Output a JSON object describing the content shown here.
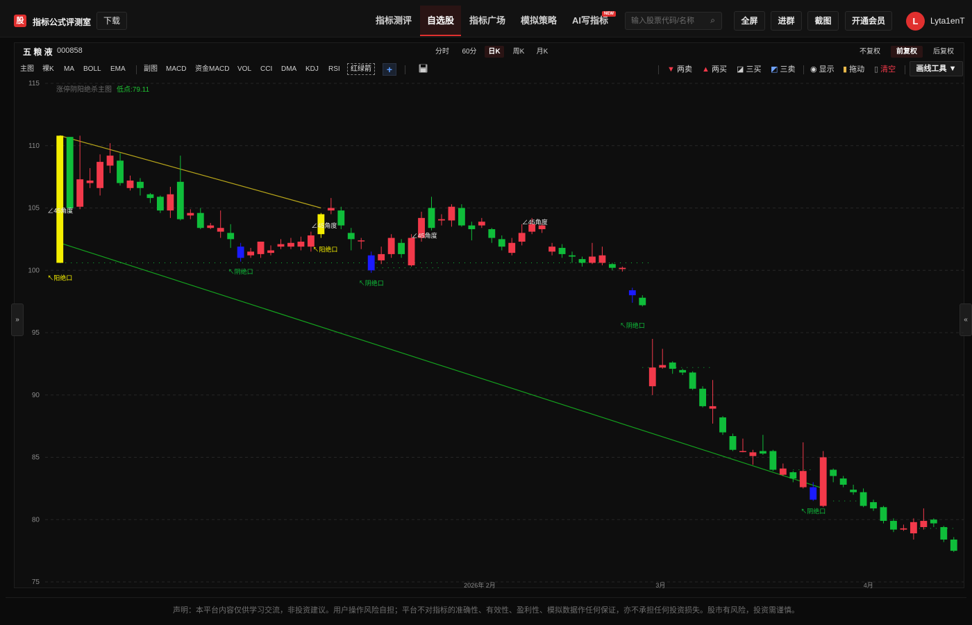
{
  "app": {
    "logo_char": "股",
    "title": "指标公式评测室",
    "download_label": "下载"
  },
  "nav": [
    {
      "label": "指标测评",
      "active": false
    },
    {
      "label": "自选股",
      "active": true
    },
    {
      "label": "指标广场",
      "active": false
    },
    {
      "label": "模拟策略",
      "active": false
    },
    {
      "label": "AI写指标",
      "active": false,
      "badge": "NEW"
    }
  ],
  "search": {
    "placeholder": "输入股票代码/名称",
    "icon": "search-icon"
  },
  "toolbar": {
    "fullscreen": "全屏",
    "join_group": "进群",
    "screenshot": "截图",
    "membership": "开通会员"
  },
  "user": {
    "initial": "L",
    "name": "Lyta1enT"
  },
  "stock": {
    "name": "五 粮 液",
    "code": "000858"
  },
  "periods": [
    {
      "label": "分时",
      "active": false
    },
    {
      "label": "60分",
      "active": false
    },
    {
      "label": "日K",
      "active": true
    },
    {
      "label": "周K",
      "active": false
    },
    {
      "label": "月K",
      "active": false
    }
  ],
  "adjust": [
    {
      "label": "不复权",
      "active": false
    },
    {
      "label": "前复权",
      "active": true
    },
    {
      "label": "后复权",
      "active": false
    }
  ],
  "indicators_main": [
    "主图",
    "裸K",
    "MA",
    "BOLL",
    "EMA"
  ],
  "indicators_sub": [
    "副图",
    "MACD",
    "资金MACD",
    "VOL",
    "CCI",
    "DMA",
    "KDJ",
    "RSI"
  ],
  "indicator_highlight": "红绿箭",
  "signals": {
    "two_sell": "两卖",
    "two_buy": "两买",
    "three_buy": "三买",
    "three_sell": "三卖",
    "show": "显示",
    "drag": "拖动",
    "clear": "清空",
    "draw_tool": "画线工具 ▼"
  },
  "colors": {
    "up": "#f2394a",
    "down": "#0fbd3a",
    "accent": "#e0302f",
    "blue": "#1b1bff",
    "yellow": "#f5ef00",
    "trend_top": "#b8a61a",
    "trend_bottom": "#14a11e"
  },
  "chart_data": {
    "type": "candlestick",
    "main_label": "涨停阴阳绝杀主图",
    "low_label": "低点:79.11",
    "y_ticks": [
      115,
      110,
      105,
      100,
      95,
      90,
      85,
      80,
      75
    ],
    "ylim": [
      75,
      115
    ],
    "x_labels": [
      "2026年 2月",
      "3月",
      "4月"
    ],
    "angle_label": "∠45角度",
    "yang_label": "↖阳绝口",
    "yin_label": "↖阴绝口",
    "candles": [
      {
        "o": 100.6,
        "c": 110.8,
        "h": 110.8,
        "l": 100.6,
        "color": "yellow"
      },
      {
        "o": 110.7,
        "c": 105.0,
        "h": 110.7,
        "l": 104.6
      },
      {
        "o": 105.1,
        "c": 107.3,
        "h": 110.8,
        "l": 104.9
      },
      {
        "o": 107.0,
        "c": 107.2,
        "h": 108.2,
        "l": 106.6
      },
      {
        "o": 106.6,
        "c": 108.7,
        "h": 109.3,
        "l": 106.0
      },
      {
        "o": 108.4,
        "c": 109.2,
        "h": 110.2,
        "l": 107.8
      },
      {
        "o": 108.8,
        "c": 107.0,
        "h": 109.4,
        "l": 106.8
      },
      {
        "o": 106.6,
        "c": 107.2,
        "h": 107.6,
        "l": 106.4
      },
      {
        "o": 107.1,
        "c": 106.6,
        "h": 107.4,
        "l": 106.0
      },
      {
        "o": 106.1,
        "c": 105.8,
        "h": 106.2,
        "l": 105.4
      },
      {
        "o": 105.9,
        "c": 104.8,
        "h": 106.0,
        "l": 104.6
      },
      {
        "o": 104.8,
        "c": 106.1,
        "h": 106.7,
        "l": 104.2
      },
      {
        "o": 107.1,
        "c": 104.1,
        "h": 109.2,
        "l": 104.0
      },
      {
        "o": 104.4,
        "c": 104.6,
        "h": 104.9,
        "l": 104.1
      },
      {
        "o": 104.6,
        "c": 103.4,
        "h": 105.0,
        "l": 103.3
      },
      {
        "o": 103.4,
        "c": 103.6,
        "h": 103.8,
        "l": 103.3
      },
      {
        "o": 103.1,
        "c": 103.4,
        "h": 104.8,
        "l": 102.6
      },
      {
        "o": 103.0,
        "c": 102.5,
        "h": 103.7,
        "l": 101.8
      },
      {
        "o": 101.9,
        "c": 101.0,
        "h": 102.2,
        "l": 100.7,
        "color": "blue"
      },
      {
        "o": 101.2,
        "c": 101.5,
        "h": 101.8,
        "l": 101.0
      },
      {
        "o": 101.3,
        "c": 102.3,
        "h": 102.3,
        "l": 101.0
      },
      {
        "o": 101.4,
        "c": 101.6,
        "h": 102.0,
        "l": 101.2
      },
      {
        "o": 101.9,
        "c": 102.1,
        "h": 102.5,
        "l": 101.7
      },
      {
        "o": 101.9,
        "c": 102.2,
        "h": 102.6,
        "l": 101.7
      },
      {
        "o": 101.9,
        "c": 102.3,
        "h": 102.7,
        "l": 101.6
      },
      {
        "o": 101.9,
        "c": 102.8,
        "h": 103.1,
        "l": 101.5
      },
      {
        "o": 102.9,
        "c": 104.5,
        "h": 104.6,
        "l": 102.6,
        "color": "yellow"
      },
      {
        "o": 104.8,
        "c": 105.0,
        "h": 105.8,
        "l": 104.5
      },
      {
        "o": 104.8,
        "c": 103.6,
        "h": 105.1,
        "l": 103.3
      },
      {
        "o": 103.0,
        "c": 102.5,
        "h": 103.4,
        "l": 101.6
      },
      {
        "o": 102.4,
        "c": 102.4,
        "h": 102.6,
        "l": 101.7
      },
      {
        "o": 101.2,
        "c": 100.0,
        "h": 101.5,
        "l": 99.8,
        "color": "blue"
      },
      {
        "o": 100.8,
        "c": 101.3,
        "h": 101.9,
        "l": 100.5
      },
      {
        "o": 101.3,
        "c": 102.6,
        "h": 102.9,
        "l": 101.0
      },
      {
        "o": 102.2,
        "c": 101.3,
        "h": 102.5,
        "l": 101.0
      },
      {
        "o": 100.4,
        "c": 102.6,
        "h": 102.9,
        "l": 100.3
      },
      {
        "o": 102.6,
        "c": 104.2,
        "h": 104.7,
        "l": 102.3
      },
      {
        "o": 105.0,
        "c": 103.4,
        "h": 105.9,
        "l": 103.2
      },
      {
        "o": 104.0,
        "c": 104.1,
        "h": 104.5,
        "l": 103.6
      },
      {
        "o": 104.0,
        "c": 105.1,
        "h": 105.3,
        "l": 103.5
      },
      {
        "o": 105.0,
        "c": 103.6,
        "h": 105.3,
        "l": 103.5
      },
      {
        "o": 103.6,
        "c": 103.3,
        "h": 103.9,
        "l": 102.4
      },
      {
        "o": 103.6,
        "c": 103.9,
        "h": 104.2,
        "l": 103.4
      },
      {
        "o": 103.3,
        "c": 102.6,
        "h": 103.4,
        "l": 102.2
      },
      {
        "o": 102.5,
        "c": 101.9,
        "h": 102.8,
        "l": 101.6
      },
      {
        "o": 101.4,
        "c": 102.2,
        "h": 102.6,
        "l": 101.2
      },
      {
        "o": 102.3,
        "c": 103.0,
        "h": 103.7,
        "l": 102.0
      },
      {
        "o": 103.1,
        "c": 103.7,
        "h": 104.2,
        "l": 102.9
      },
      {
        "o": 103.3,
        "c": 103.6,
        "h": 103.8,
        "l": 103.0
      },
      {
        "o": 101.5,
        "c": 101.9,
        "h": 102.2,
        "l": 101.2
      },
      {
        "o": 101.8,
        "c": 101.3,
        "h": 102.1,
        "l": 101.0
      },
      {
        "o": 101.2,
        "c": 101.1,
        "h": 101.5,
        "l": 100.6
      },
      {
        "o": 100.9,
        "c": 100.6,
        "h": 101.1,
        "l": 100.3
      },
      {
        "o": 100.6,
        "c": 101.1,
        "h": 102.2,
        "l": 100.5
      },
      {
        "o": 100.6,
        "c": 101.2,
        "h": 101.9,
        "l": 100.4
      },
      {
        "o": 100.5,
        "c": 100.2,
        "h": 100.6,
        "l": 100.0
      },
      {
        "o": 100.1,
        "c": 100.2,
        "h": 100.3,
        "l": 99.9
      },
      {
        "o": 98.4,
        "c": 98.0,
        "h": 98.6,
        "l": 97.4,
        "color": "blue"
      },
      {
        "o": 97.8,
        "c": 97.2,
        "h": 98.0,
        "l": 97.1
      },
      {
        "o": 90.7,
        "c": 92.2,
        "h": 94.5,
        "l": 90.0
      },
      {
        "o": 92.2,
        "c": 92.4,
        "h": 93.7,
        "l": 92.1
      },
      {
        "o": 92.6,
        "c": 92.1,
        "h": 92.7,
        "l": 91.7
      },
      {
        "o": 92.0,
        "c": 91.8,
        "h": 92.1,
        "l": 91.6
      },
      {
        "o": 91.8,
        "c": 90.5,
        "h": 91.9,
        "l": 90.4
      },
      {
        "o": 90.5,
        "c": 89.1,
        "h": 90.7,
        "l": 89.0
      },
      {
        "o": 88.9,
        "c": 89.1,
        "h": 91.2,
        "l": 87.7
      },
      {
        "o": 88.2,
        "c": 87.0,
        "h": 88.3,
        "l": 86.8
      },
      {
        "o": 86.7,
        "c": 85.6,
        "h": 86.9,
        "l": 85.5
      },
      {
        "o": 85.5,
        "c": 85.5,
        "h": 86.5,
        "l": 85.4
      },
      {
        "o": 85.1,
        "c": 85.4,
        "h": 85.6,
        "l": 84.4
      },
      {
        "o": 85.5,
        "c": 85.3,
        "h": 86.8,
        "l": 85.2
      },
      {
        "o": 85.5,
        "c": 84.0,
        "h": 85.6,
        "l": 83.9
      },
      {
        "o": 83.6,
        "c": 84.1,
        "h": 84.5,
        "l": 83.5
      },
      {
        "o": 83.8,
        "c": 83.3,
        "h": 83.9,
        "l": 83.0
      },
      {
        "o": 82.6,
        "c": 83.9,
        "h": 86.2,
        "l": 82.5
      },
      {
        "o": 82.6,
        "c": 81.6,
        "h": 83.0,
        "l": 81.5,
        "color": "blue"
      },
      {
        "o": 81.1,
        "c": 85.0,
        "h": 85.5,
        "l": 81.0
      },
      {
        "o": 84.0,
        "c": 83.5,
        "h": 84.1,
        "l": 83.0
      },
      {
        "o": 83.3,
        "c": 82.8,
        "h": 83.5,
        "l": 82.6
      },
      {
        "o": 82.4,
        "c": 82.2,
        "h": 82.8,
        "l": 82.0
      },
      {
        "o": 82.2,
        "c": 81.1,
        "h": 82.5,
        "l": 81.0
      },
      {
        "o": 81.4,
        "c": 80.9,
        "h": 81.6,
        "l": 80.7
      },
      {
        "o": 81.0,
        "c": 79.9,
        "h": 81.1,
        "l": 79.7
      },
      {
        "o": 79.9,
        "c": 79.2,
        "h": 80.1,
        "l": 79.0
      },
      {
        "o": 79.2,
        "c": 79.3,
        "h": 79.6,
        "l": 79.1
      },
      {
        "o": 78.9,
        "c": 79.8,
        "h": 80.1,
        "l": 78.4
      },
      {
        "o": 79.4,
        "c": 79.9,
        "h": 80.9,
        "l": 79.2
      },
      {
        "o": 80.0,
        "c": 79.7,
        "h": 80.1,
        "l": 79.4
      },
      {
        "o": 79.4,
        "c": 78.4,
        "h": 79.5,
        "l": 78.2
      },
      {
        "o": 78.4,
        "c": 77.5,
        "h": 78.6,
        "l": 77.4
      }
    ],
    "trend_top": {
      "from": 110.8,
      "to": 105.0
    },
    "trend_bottom": {
      "from": 102.2,
      "to": 82.5
    }
  },
  "disclaimer": "声明：本平台内容仅供学习交流，非投资建议。用户操作风险自担；平台不对指标的准确性、有效性、盈利性、模拟数据作任何保证，亦不承担任何投资损失。股市有风险，投资需谨慎。",
  "side_tabs": {
    "left": "»",
    "right": "«"
  }
}
